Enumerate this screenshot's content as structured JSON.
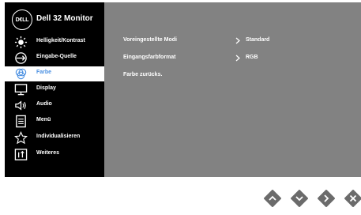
{
  "header": {
    "logo_text": "D€LL",
    "title": "Dell 32 Monitor"
  },
  "sidebar": {
    "items": [
      {
        "label": "Helligkeit/Kontrast",
        "icon": "brightness-icon"
      },
      {
        "label": "Eingabe-Quelle",
        "icon": "input-source-icon"
      },
      {
        "label": "Farbe",
        "icon": "color-icon",
        "active": true
      },
      {
        "label": "Display",
        "icon": "display-icon"
      },
      {
        "label": "Audio",
        "icon": "audio-icon"
      },
      {
        "label": "Menü",
        "icon": "menu-icon"
      },
      {
        "label": "Individualisieren",
        "icon": "star-icon"
      },
      {
        "label": "Weiteres",
        "icon": "info-icon"
      }
    ]
  },
  "panel": {
    "rows": [
      {
        "label": "Voreingestellte Modi",
        "value": "Standard"
      },
      {
        "label": "Eingangsfarbformat",
        "value": "RGB"
      },
      {
        "label": "Farbe zurücks.",
        "value": ""
      }
    ]
  },
  "buttons": [
    {
      "icon": "up-icon"
    },
    {
      "icon": "down-icon"
    },
    {
      "icon": "right-icon"
    },
    {
      "icon": "close-icon"
    }
  ],
  "colors": {
    "sidebar_bg": "#000000",
    "panel_bg": "#828282",
    "accent": "#4a90e2",
    "button_fill": "#6b6b6b"
  }
}
